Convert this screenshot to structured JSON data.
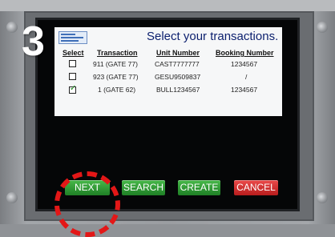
{
  "step_number": "3",
  "title": "Select your transactions.",
  "columns": [
    "Select",
    "Transaction",
    "Unit Number",
    "Booking Number"
  ],
  "rows": [
    {
      "transaction": "911 (GATE 77)",
      "unit_number": "CAST7777777",
      "booking_number": "1234567",
      "checked": false
    },
    {
      "transaction": "923 (GATE 77)",
      "unit_number": "GESU9509837",
      "booking_number": "/",
      "checked": false
    },
    {
      "transaction": "1 (GATE 62)",
      "unit_number": "BULL1234567",
      "booking_number": "1234567",
      "checked": true
    }
  ],
  "checkmark_glyph": "✓",
  "buttons": {
    "next": "NEXT",
    "search": "SEARCH",
    "create": "CREATE",
    "cancel": "CANCEL"
  },
  "colors": {
    "title": "#0b1f6e",
    "green_button": "#2e9a33",
    "red_button": "#d22b2b",
    "highlight_circle": "#e31717"
  }
}
